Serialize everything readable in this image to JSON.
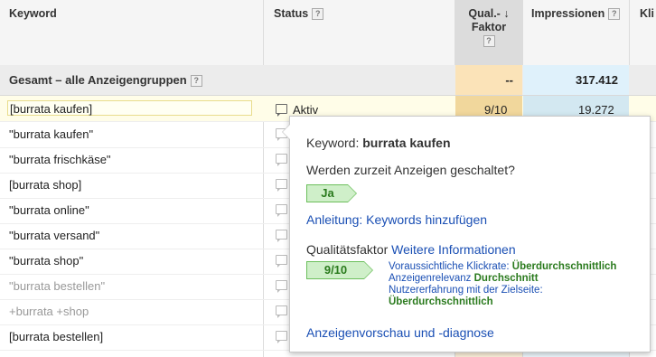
{
  "table": {
    "headers": {
      "keyword": "Keyword",
      "status": "Status",
      "qual_line1": "Qual.-",
      "qual_line2": "Faktor",
      "impressions": "Impressionen",
      "clicks_partial": "Kli"
    },
    "help_glyph": "?",
    "sort_glyph": "↓",
    "total_row": {
      "label": "Gesamt – alle Anzeigengruppen",
      "qual": "--",
      "impressions": "317.412"
    },
    "rows": [
      {
        "keyword": "[burrata kaufen]",
        "status": "Aktiv",
        "qual": "9/10",
        "impressions": "19.272",
        "muted": false
      },
      {
        "keyword": "\"burrata kaufen\"",
        "muted": false
      },
      {
        "keyword": "\"burrata frischkäse\"",
        "muted": false
      },
      {
        "keyword": "[burrata shop]",
        "muted": false
      },
      {
        "keyword": "\"burrata online\"",
        "muted": false
      },
      {
        "keyword": "\"burrata versand\"",
        "muted": false
      },
      {
        "keyword": "\"burrata shop\"",
        "muted": false
      },
      {
        "keyword": "\"burrata bestellen\"",
        "muted": true
      },
      {
        "keyword": "+burrata +shop",
        "muted": true
      },
      {
        "keyword": "[burrata bestellen]",
        "muted": false
      }
    ]
  },
  "popup": {
    "keyword_label": "Keyword:",
    "keyword_value": "burrata kaufen",
    "question": "Werden zurzeit Anzeigen geschaltet?",
    "answer": "Ja",
    "guide_link": "Anleitung: Keywords hinzufügen",
    "qs_label": "Qualitätsfaktor",
    "qs_more_link": "Weitere Informationen",
    "qs_score": "9/10",
    "ctr_label": "Voraussichtliche Klickrate:",
    "ctr_value": "Überdurchschnittlich",
    "relevance_label": "Anzeigenrelevanz",
    "relevance_value": "Durchschnitt",
    "landing_label": "Nutzererfahrung mit der Zielseite:",
    "landing_value": "Überdurchschnittlich",
    "preview_link": "Anzeigenvorschau und -diagnose"
  },
  "colors": {
    "qual_column": "#fbe3b8",
    "impressions_column": "#dff1fb",
    "badge_fill": "#cfefc9",
    "link": "#1a4fb4"
  }
}
